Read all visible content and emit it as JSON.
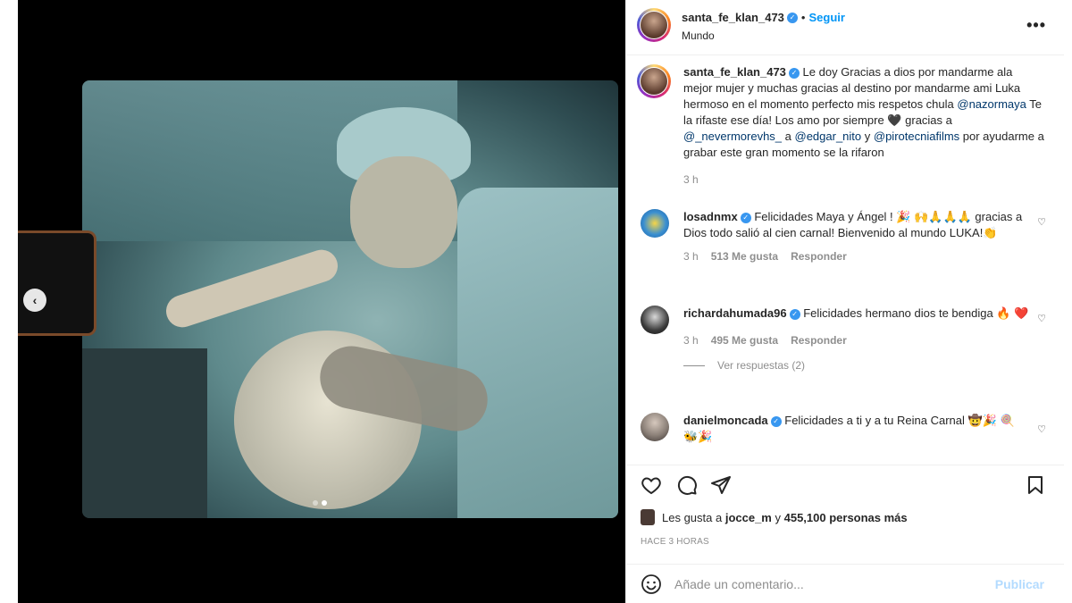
{
  "post": {
    "username": "santa_fe_klan_473",
    "follow_label": "Seguir",
    "location": "Mundo",
    "more_label": "•••",
    "caption_parts": [
      {
        "t": "Le doy Gracias a dios por mandarme ala mejor mujer y muchas gracias al destino por mandarme ami Luka hermoso en el momento perfecto mis respetos chula ",
        "m": false
      },
      {
        "t": "@nazormaya",
        "m": true
      },
      {
        "t": " Te la rifaste ese día! Los amo por siempre 🖤 gracias a ",
        "m": false
      },
      {
        "t": "@_nevermorevhs_",
        "m": true
      },
      {
        "t": " a ",
        "m": false
      },
      {
        "t": "@edgar_nito",
        "m": true
      },
      {
        "t": " y ",
        "m": false
      },
      {
        "t": "@pirotecniafilms",
        "m": true
      },
      {
        "t": " por ayudarme a grabar este gran momento se la rifaron",
        "m": false
      }
    ],
    "caption_time": "3 h"
  },
  "comments": [
    {
      "user": "losadnmx",
      "text": "Felicidades Maya y Ángel ! 🎉 🙌🙏🙏🙏 gracias a Dios todo salió al cien carnal! Bienvenido al mundo LUKA!👏",
      "time": "3 h",
      "likes": "513 Me gusta",
      "reply": "Responder",
      "avatar": "#3a8fd1"
    },
    {
      "user": "richardahumada96",
      "text": "Felicidades hermano dios te bendiga 🔥 ❤️",
      "time": "3 h",
      "likes": "495 Me gusta",
      "reply": "Responder",
      "avatar": "#2b2b2b",
      "view_replies": "Ver respuestas (2)"
    },
    {
      "user": "danielmoncada",
      "text": "Felicidades a ti y a tu Reina Carnal 🤠🎉 🍭 🐝🎉",
      "avatar": "#9a8f86"
    }
  ],
  "likes_line": {
    "prefix": "Les gusta a ",
    "user": "jocce_m",
    "mid": " y ",
    "count": "455,100 personas más"
  },
  "timestamp": "HACE 3 HORAS",
  "add_comment": {
    "placeholder": "Añade un comentario...",
    "post_label": "Publicar"
  },
  "media": {
    "nav_prev": "‹",
    "slides": 2,
    "active_slide": 1
  },
  "colors": {
    "accent": "#0095f6",
    "mention": "#00376b",
    "muted": "#8e8e8e"
  }
}
